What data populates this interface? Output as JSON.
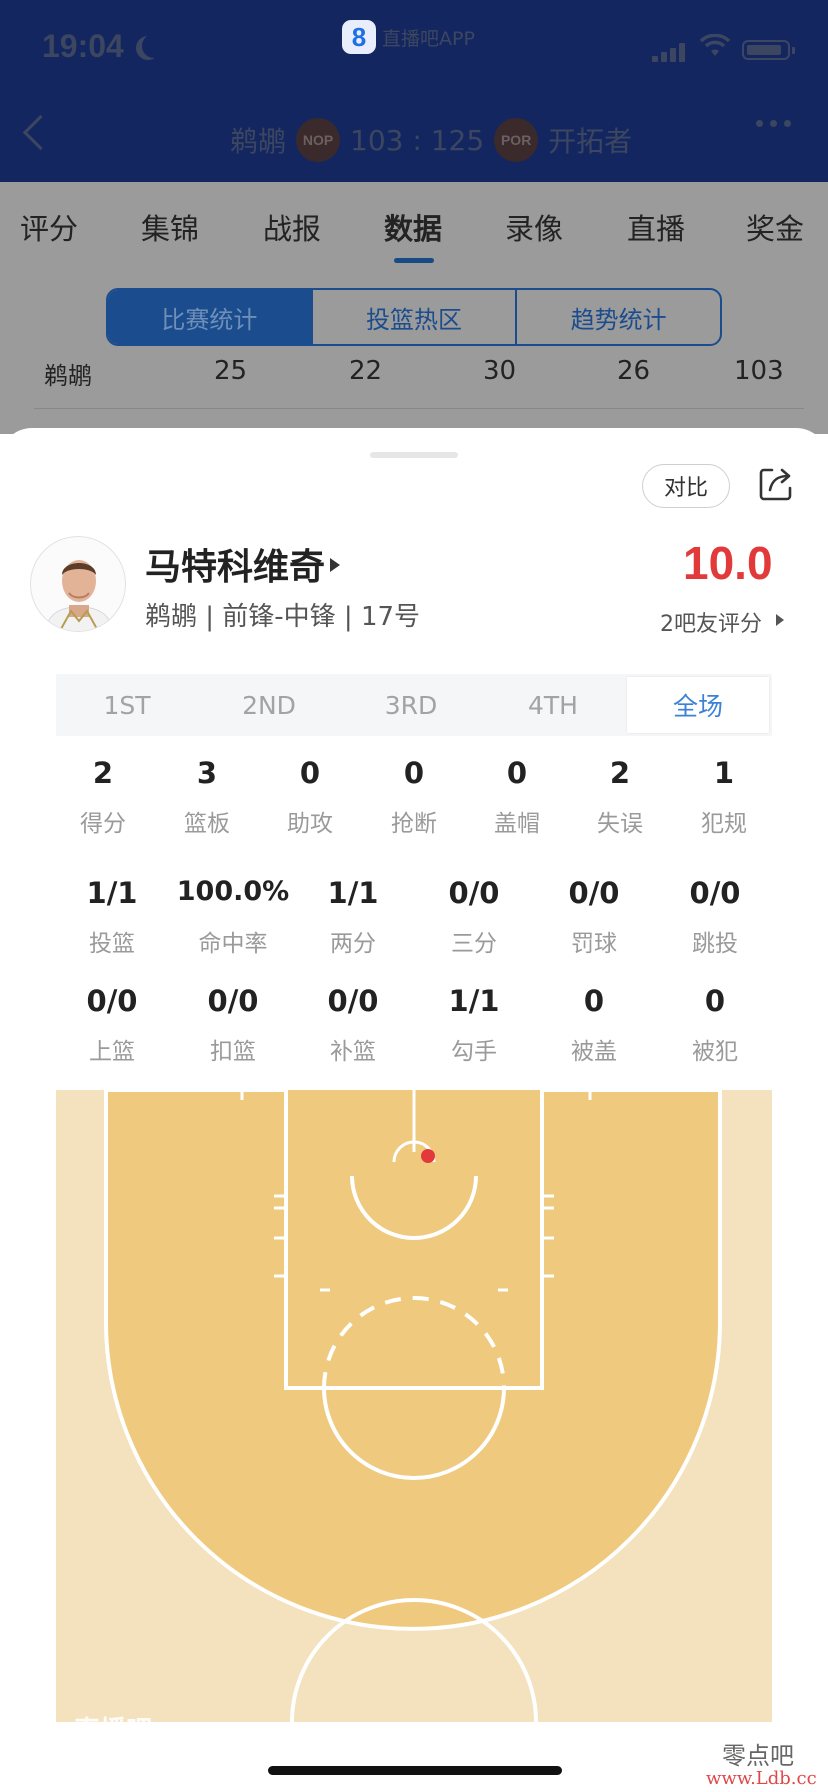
{
  "status_bar": {
    "time": "19:04",
    "app_name": "直播吧APP",
    "app_logo": "8"
  },
  "header": {
    "home_team": "鹈鹕",
    "home_abbr": "NOP",
    "score": "103 : 125",
    "away_team": "开拓者",
    "away_abbr": "POR"
  },
  "nav": {
    "tabs": [
      "评分",
      "集锦",
      "战报",
      "数据",
      "录像",
      "直播",
      "奖金"
    ],
    "active": "数据"
  },
  "segment": {
    "tabs": [
      "比赛统计",
      "投篮热区",
      "趋势统计"
    ],
    "active": "比赛统计"
  },
  "score_row": {
    "team": "鹈鹕",
    "quarters": [
      "25",
      "22",
      "30",
      "26",
      "103"
    ]
  },
  "player_card": {
    "compare_label": "对比",
    "name": "马特科维奇",
    "info": "鹈鹕 | 前锋-中锋 | 17号",
    "rating": "10.0",
    "rating_sub": "2吧友评分"
  },
  "periods": {
    "tabs": [
      "1ST",
      "2ND",
      "3RD",
      "4TH",
      "全场"
    ],
    "active": "全场"
  },
  "stats_row1": [
    {
      "value": "2",
      "label": "得分"
    },
    {
      "value": "3",
      "label": "篮板"
    },
    {
      "value": "0",
      "label": "助攻"
    },
    {
      "value": "0",
      "label": "抢断"
    },
    {
      "value": "0",
      "label": "盖帽"
    },
    {
      "value": "2",
      "label": "失误"
    },
    {
      "value": "1",
      "label": "犯规"
    }
  ],
  "stats_row2": [
    {
      "value": "1/1",
      "label": "投篮"
    },
    {
      "value": "100.0%",
      "label": "命中率"
    },
    {
      "value": "1/1",
      "label": "两分"
    },
    {
      "value": "0/0",
      "label": "三分"
    },
    {
      "value": "0/0",
      "label": "罚球"
    },
    {
      "value": "0/0",
      "label": "跳投"
    }
  ],
  "stats_row3": [
    {
      "value": "0/0",
      "label": "上篮"
    },
    {
      "value": "0/0",
      "label": "扣篮"
    },
    {
      "value": "0/0",
      "label": "补篮"
    },
    {
      "value": "1/1",
      "label": "勾手"
    },
    {
      "value": "0",
      "label": "被盖"
    },
    {
      "value": "0",
      "label": "被犯"
    }
  ],
  "court": {
    "watermark": "直播吧",
    "shot_color": "#e23a3a"
  },
  "watermark_site": {
    "line1": "零点吧",
    "line2": "www.Ldb.cc"
  },
  "colors": {
    "header_bg": "#13265f",
    "accent": "#1b4d8e",
    "rating": "#e23a3a",
    "court_paint": "#efc97e",
    "court_floor": "#f4e1bd"
  }
}
